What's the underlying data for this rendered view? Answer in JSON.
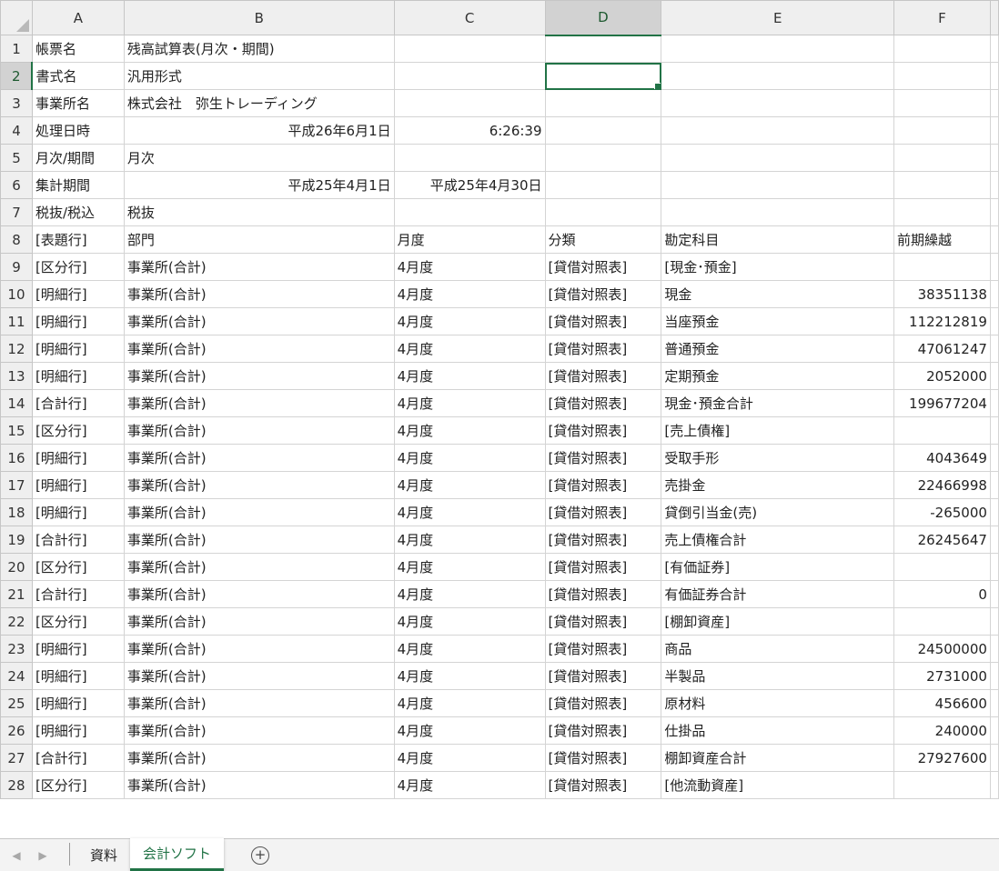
{
  "columns": [
    "A",
    "B",
    "C",
    "D",
    "E",
    "F"
  ],
  "selected_column": "D",
  "selected_row": "2",
  "rows": [
    {
      "n": "1",
      "a": "帳票名",
      "b": "残高試算表(月次・期間)",
      "c": "",
      "d": "",
      "e": "",
      "f": ""
    },
    {
      "n": "2",
      "a": "書式名",
      "b": "汎用形式",
      "c": "",
      "d": "",
      "e": "",
      "f": ""
    },
    {
      "n": "3",
      "a": "事業所名",
      "b": "株式会社　弥生トレーディング",
      "c": "",
      "d": "",
      "e": "",
      "f": ""
    },
    {
      "n": "4",
      "a": "処理日時",
      "b": "平成26年6月1日",
      "c": "6:26:39",
      "d": "",
      "e": "",
      "f": ""
    },
    {
      "n": "5",
      "a": "月次/期間",
      "b": "月次",
      "c": "",
      "d": "",
      "e": "",
      "f": ""
    },
    {
      "n": "6",
      "a": "集計期間",
      "b": "平成25年4月1日",
      "c": "平成25年4月30日",
      "d": "",
      "e": "",
      "f": ""
    },
    {
      "n": "7",
      "a": "税抜/税込",
      "b": "税抜",
      "c": "",
      "d": "",
      "e": "",
      "f": ""
    },
    {
      "n": "8",
      "a": "[表題行]",
      "b": "部門",
      "c": "月度",
      "d": "分類",
      "e": "勘定科目",
      "f": "前期繰越"
    },
    {
      "n": "9",
      "a": "[区分行]",
      "b": "事業所(合計)",
      "c": "4月度",
      "d": "[貸借対照表]",
      "e": "[現金･預金]",
      "f": ""
    },
    {
      "n": "10",
      "a": "[明細行]",
      "b": "事業所(合計)",
      "c": "4月度",
      "d": "[貸借対照表]",
      "e": "現金",
      "f": "38351138"
    },
    {
      "n": "11",
      "a": "[明細行]",
      "b": "事業所(合計)",
      "c": "4月度",
      "d": "[貸借対照表]",
      "e": "当座預金",
      "f": "112212819"
    },
    {
      "n": "12",
      "a": "[明細行]",
      "b": "事業所(合計)",
      "c": "4月度",
      "d": "[貸借対照表]",
      "e": "普通預金",
      "f": "47061247"
    },
    {
      "n": "13",
      "a": "[明細行]",
      "b": "事業所(合計)",
      "c": "4月度",
      "d": "[貸借対照表]",
      "e": "定期預金",
      "f": "2052000"
    },
    {
      "n": "14",
      "a": "[合計行]",
      "b": "事業所(合計)",
      "c": "4月度",
      "d": "[貸借対照表]",
      "e": "現金･預金合計",
      "f": "199677204"
    },
    {
      "n": "15",
      "a": "[区分行]",
      "b": "事業所(合計)",
      "c": "4月度",
      "d": "[貸借対照表]",
      "e": "[売上債権]",
      "f": ""
    },
    {
      "n": "16",
      "a": "[明細行]",
      "b": "事業所(合計)",
      "c": "4月度",
      "d": "[貸借対照表]",
      "e": "受取手形",
      "f": "4043649"
    },
    {
      "n": "17",
      "a": "[明細行]",
      "b": "事業所(合計)",
      "c": "4月度",
      "d": "[貸借対照表]",
      "e": "売掛金",
      "f": "22466998"
    },
    {
      "n": "18",
      "a": "[明細行]",
      "b": "事業所(合計)",
      "c": "4月度",
      "d": "[貸借対照表]",
      "e": "貸倒引当金(売)",
      "f": "-265000"
    },
    {
      "n": "19",
      "a": "[合計行]",
      "b": "事業所(合計)",
      "c": "4月度",
      "d": "[貸借対照表]",
      "e": "売上債権合計",
      "f": "26245647"
    },
    {
      "n": "20",
      "a": "[区分行]",
      "b": "事業所(合計)",
      "c": "4月度",
      "d": "[貸借対照表]",
      "e": "[有価証券]",
      "f": ""
    },
    {
      "n": "21",
      "a": "[合計行]",
      "b": "事業所(合計)",
      "c": "4月度",
      "d": "[貸借対照表]",
      "e": "有価証券合計",
      "f": "0"
    },
    {
      "n": "22",
      "a": "[区分行]",
      "b": "事業所(合計)",
      "c": "4月度",
      "d": "[貸借対照表]",
      "e": "[棚卸資産]",
      "f": ""
    },
    {
      "n": "23",
      "a": "[明細行]",
      "b": "事業所(合計)",
      "c": "4月度",
      "d": "[貸借対照表]",
      "e": "商品",
      "f": "24500000"
    },
    {
      "n": "24",
      "a": "[明細行]",
      "b": "事業所(合計)",
      "c": "4月度",
      "d": "[貸借対照表]",
      "e": "半製品",
      "f": "2731000"
    },
    {
      "n": "25",
      "a": "[明細行]",
      "b": "事業所(合計)",
      "c": "4月度",
      "d": "[貸借対照表]",
      "e": "原材料",
      "f": "456600"
    },
    {
      "n": "26",
      "a": "[明細行]",
      "b": "事業所(合計)",
      "c": "4月度",
      "d": "[貸借対照表]",
      "e": "仕掛品",
      "f": "240000"
    },
    {
      "n": "27",
      "a": "[合計行]",
      "b": "事業所(合計)",
      "c": "4月度",
      "d": "[貸借対照表]",
      "e": "棚卸資産合計",
      "f": "27927600"
    },
    {
      "n": "28",
      "a": "[区分行]",
      "b": "事業所(合計)",
      "c": "4月度",
      "d": "[貸借対照表]",
      "e": "[他流動資産]",
      "f": ""
    }
  ],
  "right_aligned": [
    {
      "row": "4",
      "col": "b"
    },
    {
      "row": "4",
      "col": "c"
    },
    {
      "row": "6",
      "col": "b"
    },
    {
      "row": "6",
      "col": "c"
    }
  ],
  "sheet_tabs": [
    {
      "label": "資料",
      "active": false
    },
    {
      "label": "会計ソフト",
      "active": true
    }
  ],
  "icons": {
    "nav_prev": "chevron-left-icon",
    "nav_next": "chevron-right-icon",
    "add_sheet": "plus-circle-icon"
  },
  "colors": {
    "accent": "#217346",
    "header_bg": "#efefef",
    "selected_header_bg": "#d2d2d2"
  }
}
